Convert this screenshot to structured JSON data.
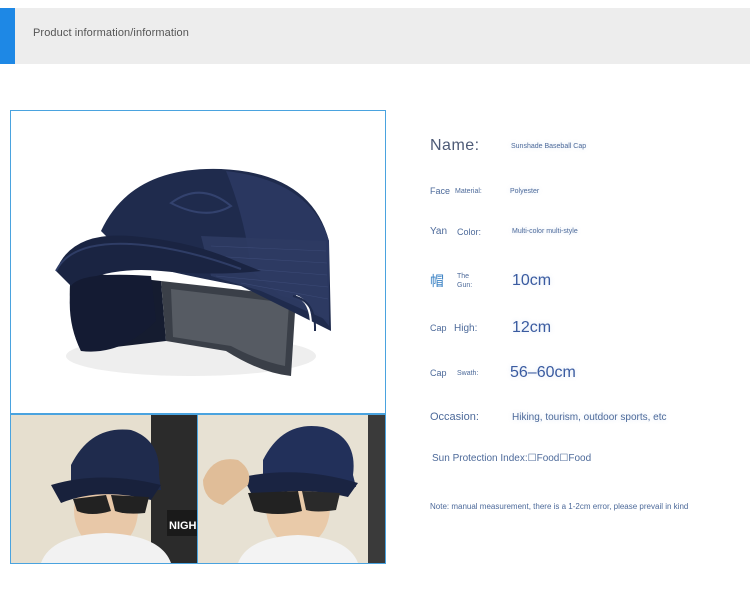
{
  "header": {
    "title": "Product information/information"
  },
  "specs": {
    "name_label": "Name:",
    "name_value": "Sunshade Baseball Cap",
    "row2_prefix": "Face",
    "material_label": "Material:",
    "material_value": "Polyester",
    "row3_prefix": "Yan",
    "color_label": "Color:",
    "color_value": "Multi-color multi-style",
    "row4_prefix": "帽",
    "gun_label": "The Gun:",
    "gun_value": "10cm",
    "row5_prefix": "Cap",
    "high_label": "High:",
    "high_value": "12cm",
    "row6_prefix": "Cap",
    "swath_label": "Swath:",
    "swath_value": "56–60cm",
    "occasion_label": "Occasion:",
    "occasion_value": "Hiking, tourism, outdoor sports, etc",
    "sun_protection": "Sun Protection Index:☐Food☐Food",
    "note": "Note: manual measurement, there is a 1-2cm error, please prevail in kind"
  },
  "images": {
    "thumb_left_sign": "NIGH"
  },
  "colors": {
    "accent": "#1e88e5",
    "cap_navy": "#1f2b4d",
    "border": "#4aa3df"
  }
}
